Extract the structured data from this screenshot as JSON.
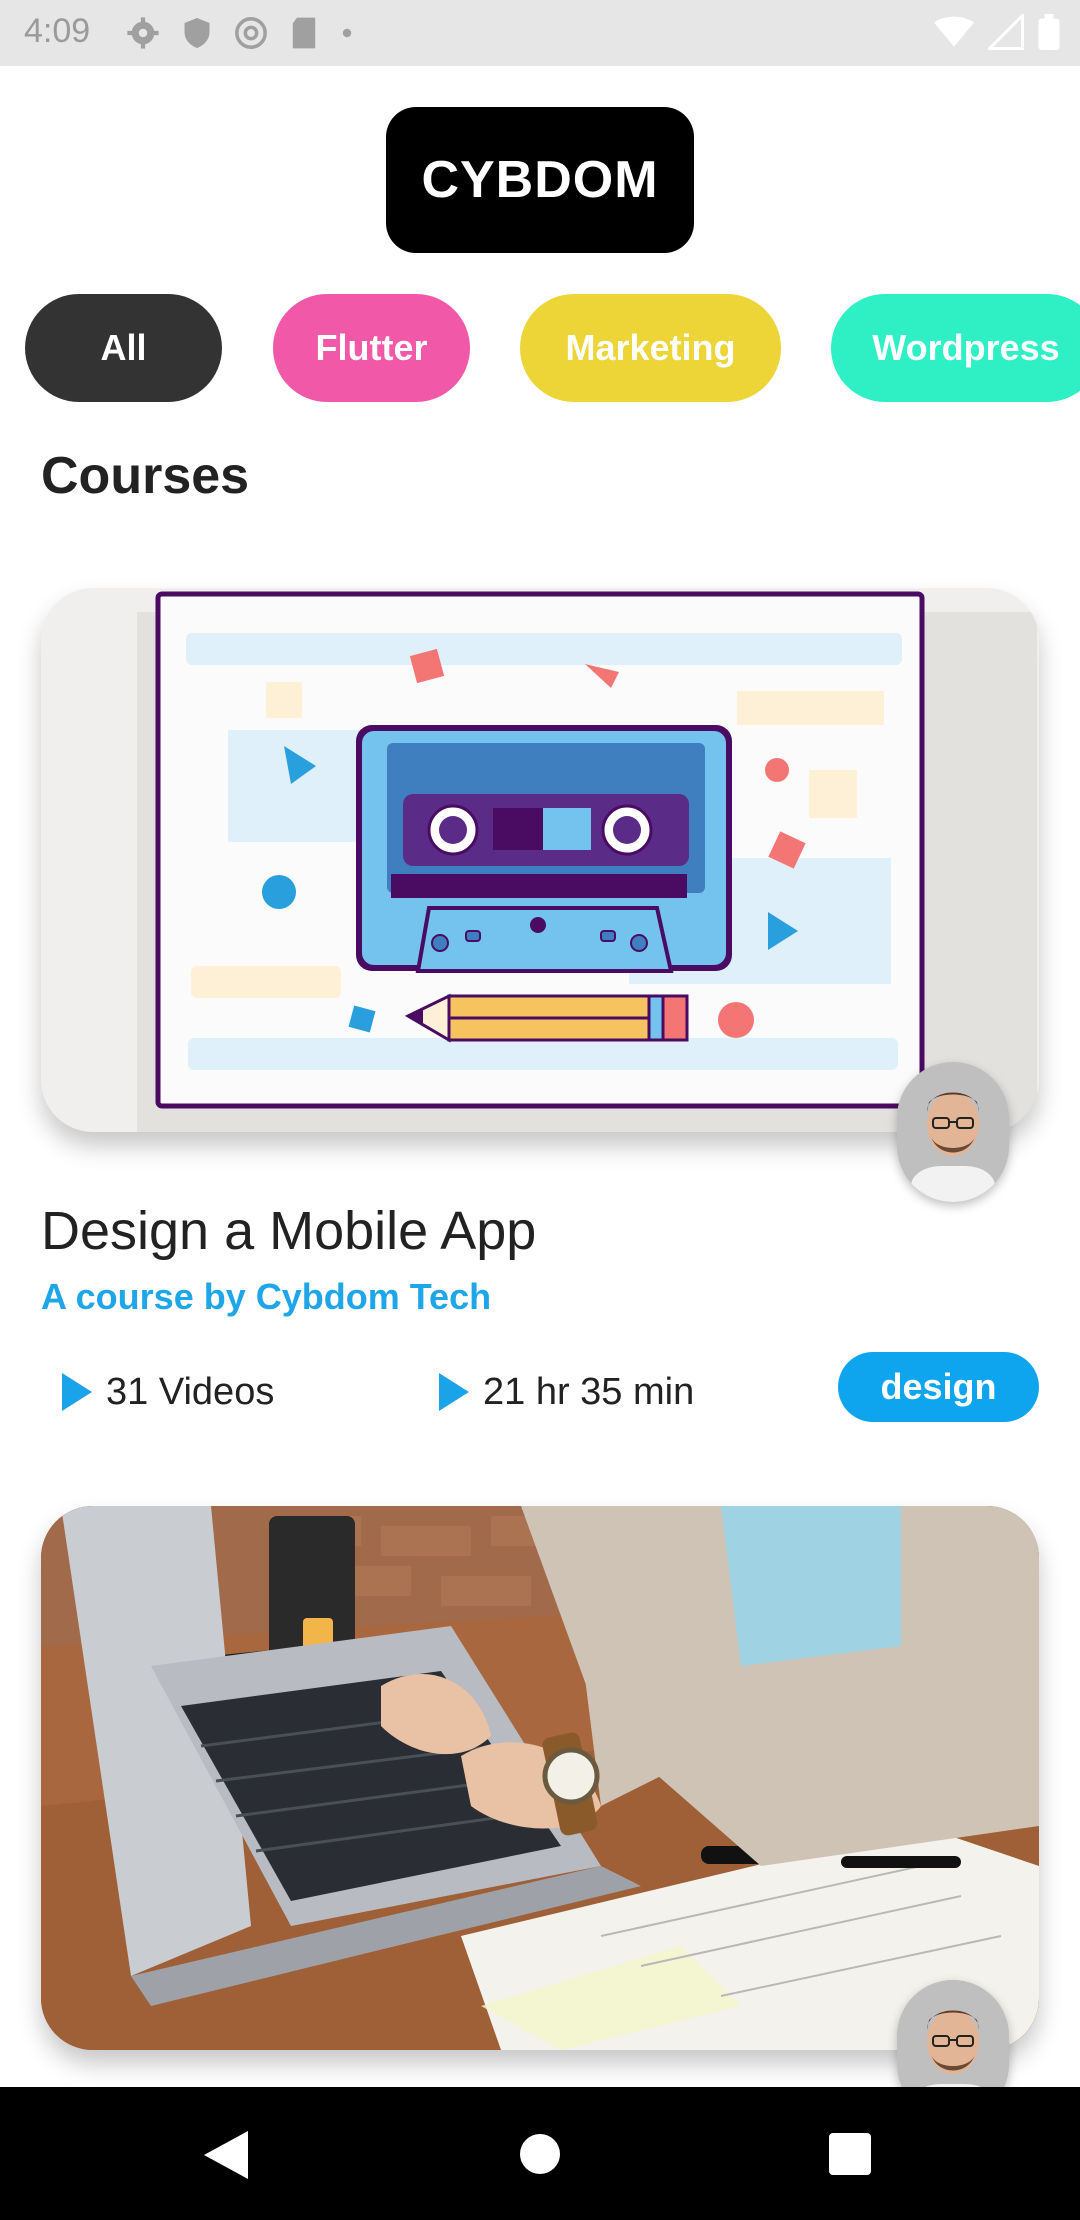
{
  "status_bar": {
    "time": "4:09"
  },
  "app": {
    "logo_text": "CYBDOM"
  },
  "categories": [
    {
      "label": "All",
      "color": "#333333"
    },
    {
      "label": "Flutter",
      "color": "#f158a8"
    },
    {
      "label": "Marketing",
      "color": "#edd437"
    },
    {
      "label": "Wordpress",
      "color": "#2ff0c4"
    }
  ],
  "section_title": "Courses",
  "courses": [
    {
      "title": "Design a Mobile App",
      "subtitle": "A course by Cybdom Tech",
      "videos": "31 Videos",
      "duration": "21 hr 35 min",
      "tag": "design",
      "image": "cassette-illustration",
      "author_avatar": "avatar-man-glasses"
    },
    {
      "image": "laptop-typing-photo",
      "author_avatar": "avatar-man-glasses"
    }
  ],
  "colors": {
    "accent_blue": "#1ea6e8",
    "tag_blue": "#0fa5ee",
    "play_icon": "#1aa3e8"
  },
  "nav": {
    "back": "back-icon",
    "home": "home-icon",
    "recents": "recents-icon"
  }
}
